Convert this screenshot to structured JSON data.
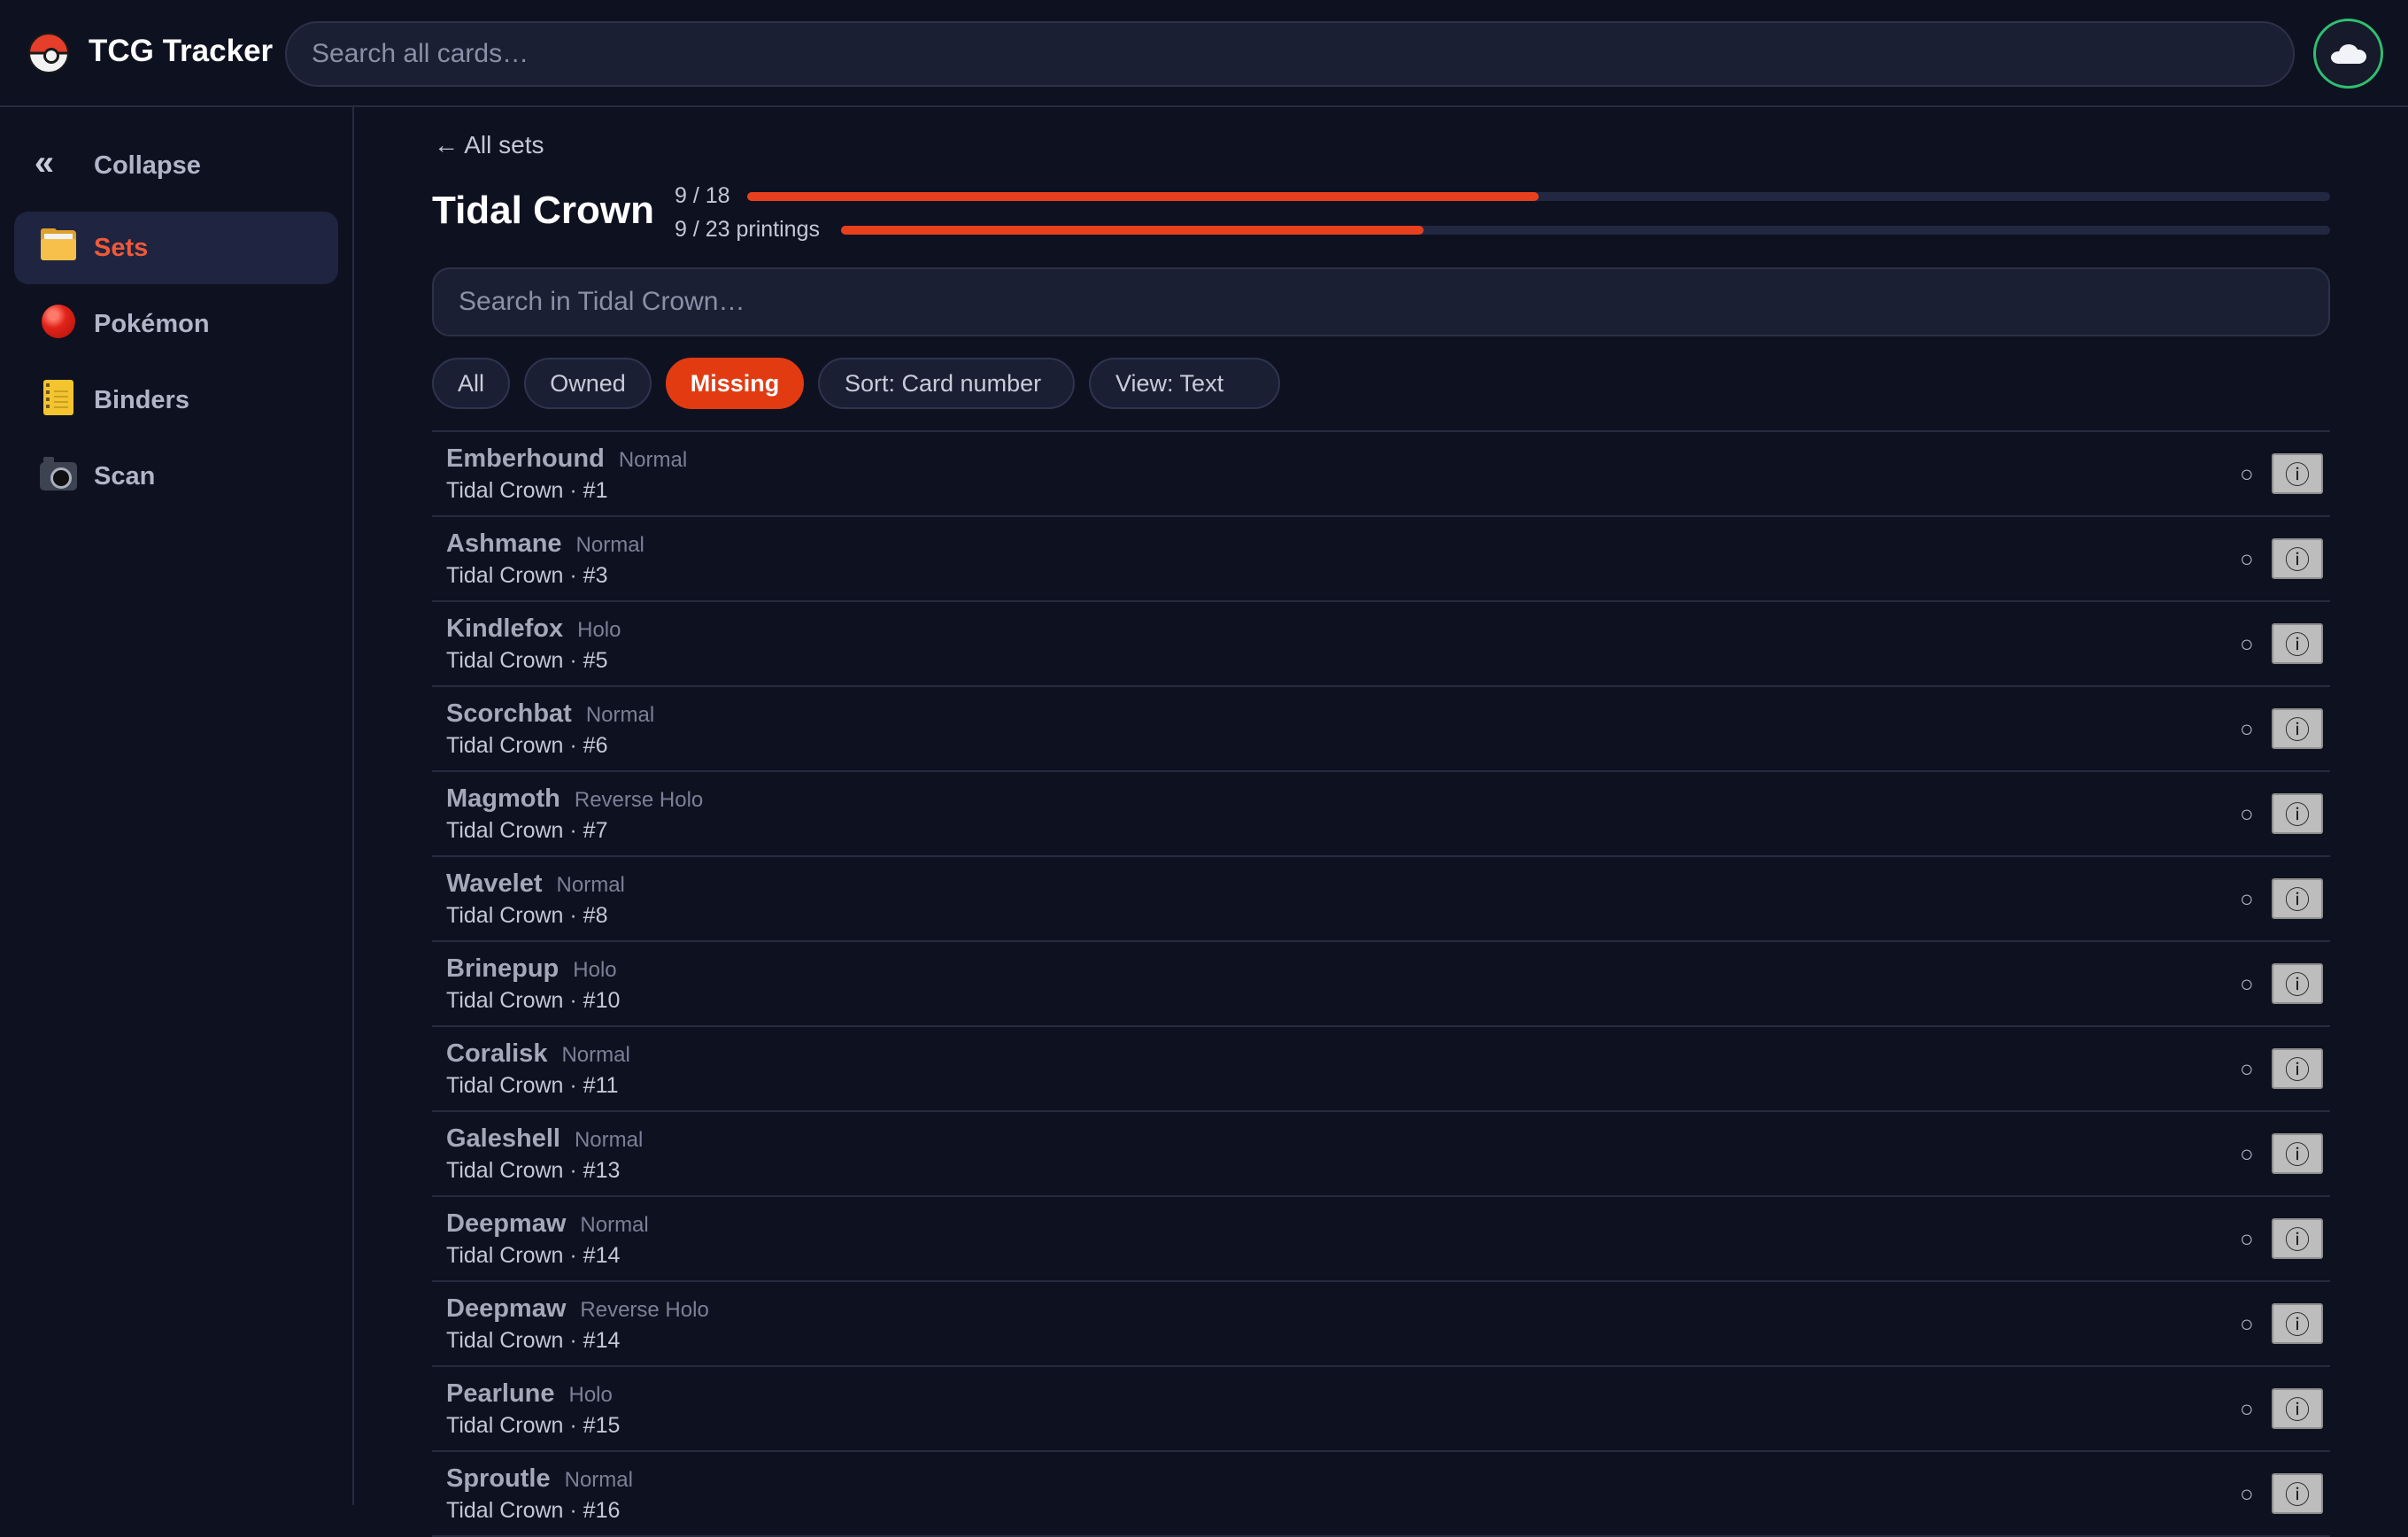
{
  "app": {
    "title": "TCG Tracker",
    "search_placeholder": "Search all cards…"
  },
  "sidebar": {
    "collapse_label": "Collapse",
    "collapse_icon": "«",
    "items": [
      {
        "label": "Sets",
        "icon": "card-index-dividers-icon",
        "active": true
      },
      {
        "label": "Pokémon",
        "icon": "red-ball-icon",
        "active": false
      },
      {
        "label": "Binders",
        "icon": "ledger-icon",
        "active": false
      },
      {
        "label": "Scan",
        "icon": "camera-icon",
        "active": false
      }
    ]
  },
  "main": {
    "back_label": "← All sets",
    "set_title": "Tidal Crown",
    "progress": [
      {
        "label": "9 / 18",
        "fraction": 0.5
      },
      {
        "label": "9 / 23 printings",
        "fraction": 0.391
      }
    ],
    "search_placeholder": "Search in Tidal Crown…",
    "filters": [
      {
        "label": "All",
        "active": false
      },
      {
        "label": "Owned",
        "active": false
      },
      {
        "label": "Missing",
        "active": true
      },
      {
        "label": "Sort: Card number",
        "active": false
      },
      {
        "label": "View: Text",
        "active": false
      }
    ],
    "owned_marker": "○",
    "info_glyph": "ⓘ",
    "cards": [
      {
        "name": "Emberhound",
        "variant": "Normal",
        "sub": "Tidal Crown · #1"
      },
      {
        "name": "Ashmane",
        "variant": "Normal",
        "sub": "Tidal Crown · #3"
      },
      {
        "name": "Kindlefox",
        "variant": "Holo",
        "sub": "Tidal Crown · #5"
      },
      {
        "name": "Scorchbat",
        "variant": "Normal",
        "sub": "Tidal Crown · #6"
      },
      {
        "name": "Magmoth",
        "variant": "Reverse Holo",
        "sub": "Tidal Crown · #7"
      },
      {
        "name": "Wavelet",
        "variant": "Normal",
        "sub": "Tidal Crown · #8"
      },
      {
        "name": "Brinepup",
        "variant": "Holo",
        "sub": "Tidal Crown · #10"
      },
      {
        "name": "Coralisk",
        "variant": "Normal",
        "sub": "Tidal Crown · #11"
      },
      {
        "name": "Galeshell",
        "variant": "Normal",
        "sub": "Tidal Crown · #13"
      },
      {
        "name": "Deepmaw",
        "variant": "Normal",
        "sub": "Tidal Crown · #14"
      },
      {
        "name": "Deepmaw",
        "variant": "Reverse Holo",
        "sub": "Tidal Crown · #14"
      },
      {
        "name": "Pearlune",
        "variant": "Holo",
        "sub": "Tidal Crown · #15"
      },
      {
        "name": "Sproutle",
        "variant": "Normal",
        "sub": "Tidal Crown · #16"
      }
    ]
  },
  "colors": {
    "accent": "#e8401f",
    "active_chip": "#e23b12",
    "cloud_ring": "#2fbf71",
    "background": "#0e1120"
  }
}
